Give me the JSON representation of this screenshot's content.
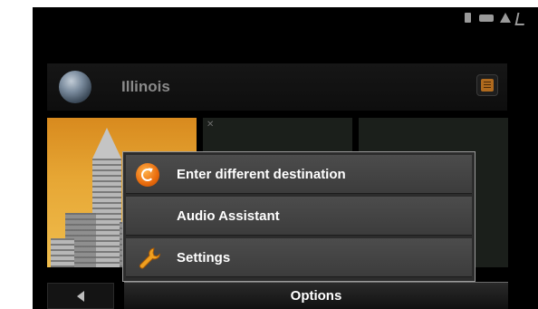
{
  "header": {
    "region_label": "Illinois"
  },
  "options_menu": {
    "items": [
      {
        "label": "Enter different destination",
        "icon": "refresh-icon"
      },
      {
        "label": "Audio Assistant",
        "icon": ""
      },
      {
        "label": "Settings",
        "icon": "wrench-icon"
      }
    ],
    "title": "Options"
  },
  "colors": {
    "accent": "#e8780e",
    "popup_item": "#454545",
    "background": "#000000"
  },
  "status_icons": [
    "sim-card-icon",
    "battery-icon",
    "warning-icon",
    "signal-icon"
  ]
}
